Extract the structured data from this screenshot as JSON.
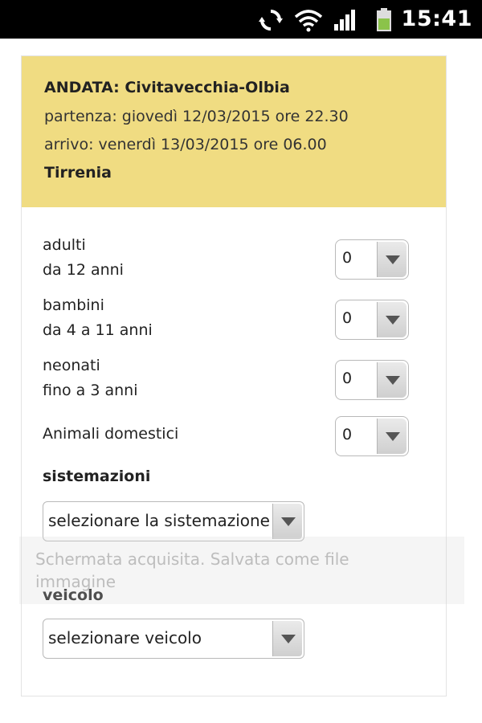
{
  "status_bar": {
    "time": "15:41",
    "icons": [
      "sync-icon",
      "wifi-icon",
      "signal-icon",
      "battery-icon"
    ],
    "battery_color": "#8bc34a"
  },
  "trip": {
    "title": "ANDATA: Civitavecchia-Olbia",
    "departure": "partenza: giovedì 12/03/2015 ore 22.30",
    "arrival": "arrivo: venerdì 13/03/2015 ore 06.00",
    "operator": "Tirrenia",
    "background_color": "#f0dc82"
  },
  "passengers": [
    {
      "label_line1": "adulti",
      "label_line2": "da 12 anni",
      "value": "0"
    },
    {
      "label_line1": "bambini",
      "label_line2": "da 4 a 11 anni",
      "value": "0"
    },
    {
      "label_line1": "neonati",
      "label_line2": "fino a 3 anni",
      "value": "0"
    },
    {
      "label_line1": "Animali domestici",
      "label_line2": "",
      "value": "0"
    }
  ],
  "sistemazioni": {
    "title": "sistemazioni",
    "select_value": "selezionare la sistemazione"
  },
  "veicolo": {
    "title": "veicolo",
    "select_value": "selezionare veicolo"
  },
  "toast": {
    "text": "Schermata acquisita. Salvata come file immagine"
  }
}
